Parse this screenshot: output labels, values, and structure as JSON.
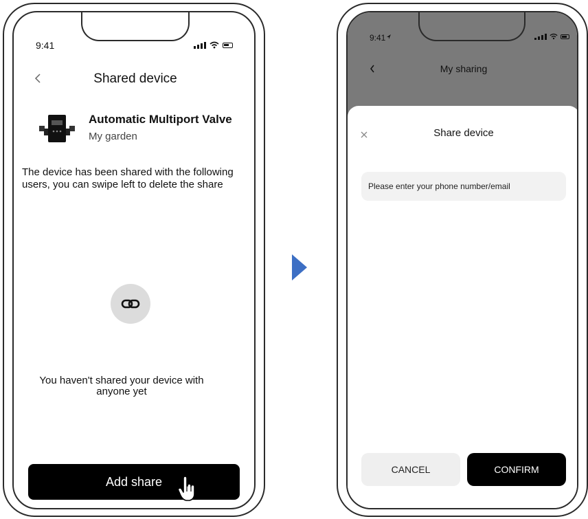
{
  "left_screen": {
    "status_time": "9:41",
    "header": {
      "back_icon": "chevron-left-icon",
      "title": "Shared device"
    },
    "device": {
      "name": "Automatic Multiport Valve",
      "location": "My garden",
      "image_icon": "valve-device-icon"
    },
    "description": "The device has been shared with the following users, you can swipe left to delete the share",
    "empty_icon": "link-icon",
    "empty_message": "You haven't shared your device with anyone yet",
    "add_share_label": "Add share",
    "cursor_icon": "hand-pointer-icon"
  },
  "arrow_icon": "triangle-right-icon",
  "arrow_color": "#3d6fc4",
  "right_screen": {
    "status_time": "9:41",
    "header": {
      "back_icon": "chevron-left-icon",
      "title": "My sharing"
    },
    "sheet": {
      "close_icon": "close-icon",
      "title": "Share device",
      "input_placeholder": "Please enter your phone number/email",
      "cancel_label": "CANCEL",
      "confirm_label": "CONFIRM"
    },
    "overlay_color": "#7a7a7a"
  }
}
